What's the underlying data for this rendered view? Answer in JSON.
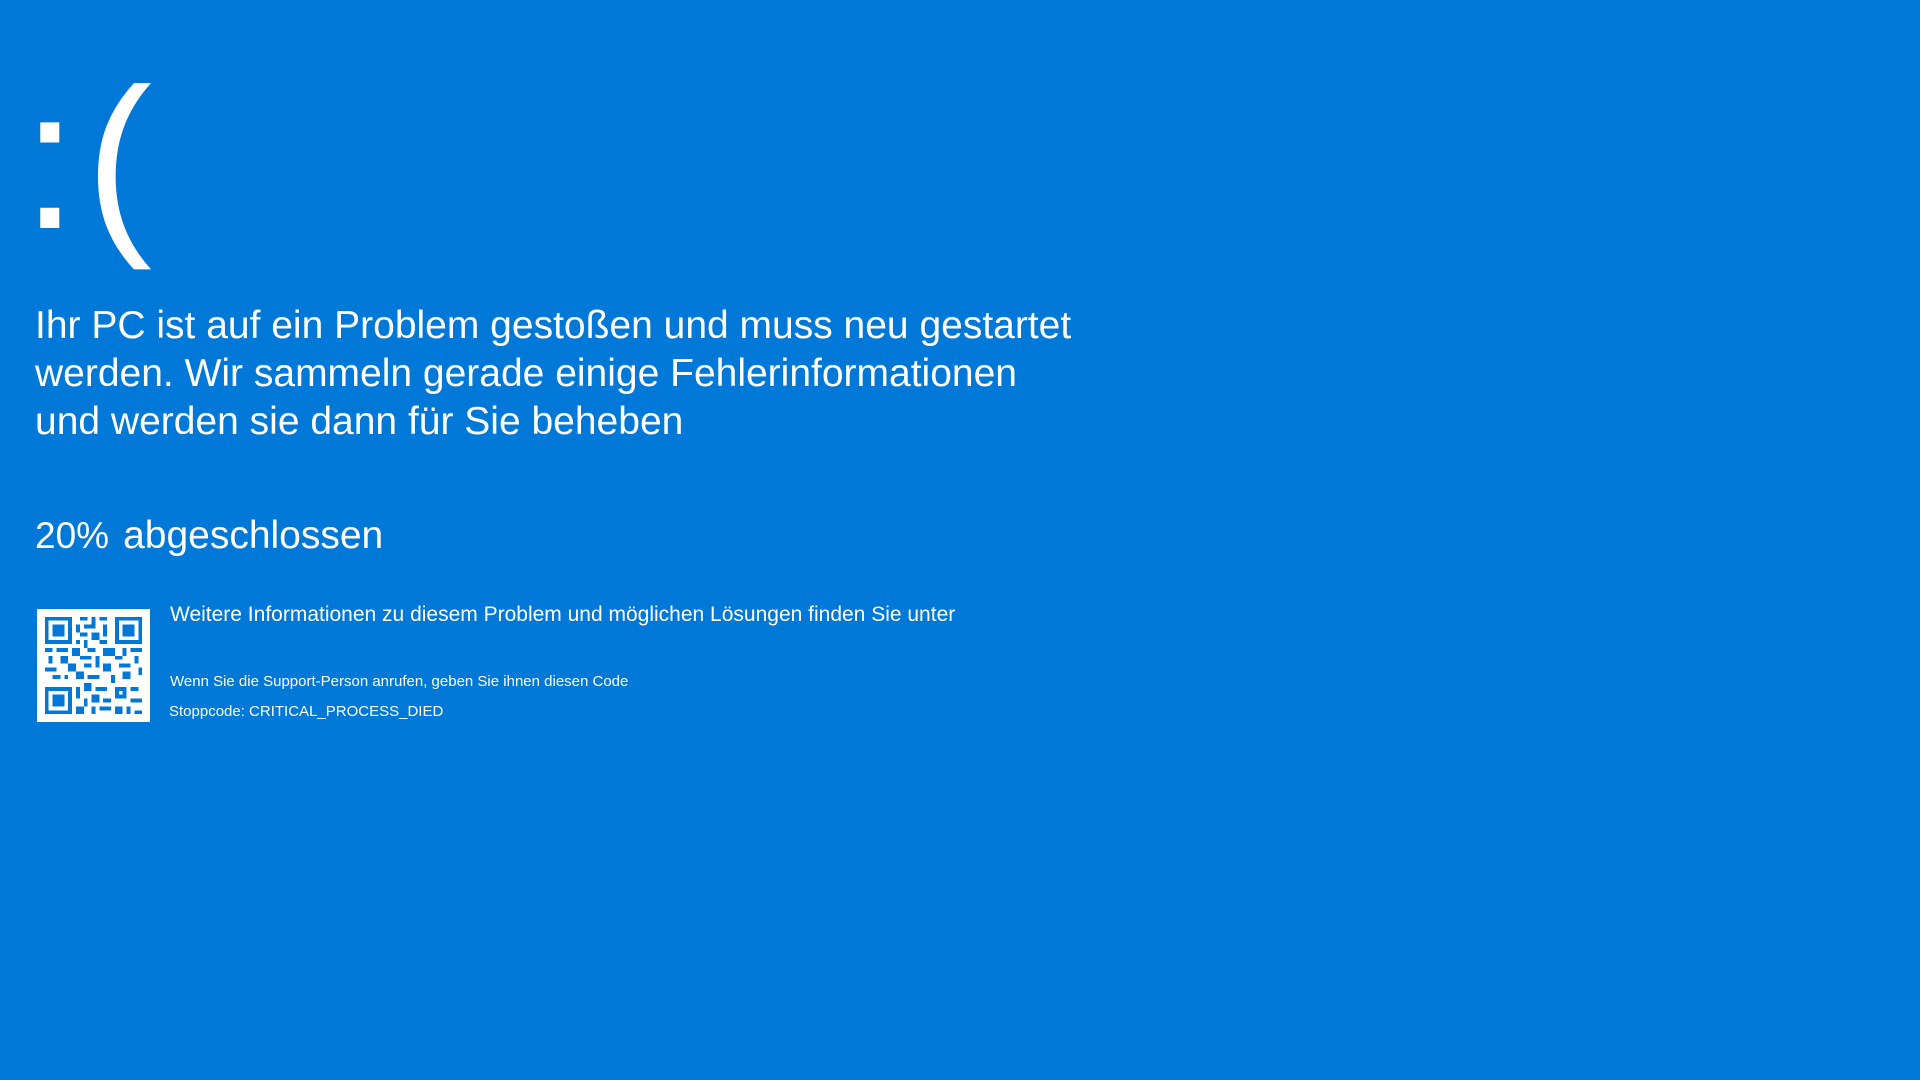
{
  "screen": {
    "background_color": "#0078d7",
    "text_color": "#ffffff",
    "sad_face": ":(",
    "message_lines": [
      "Ihr PC ist auf ein Problem gestoßen und muss neu gestartet",
      "werden. Wir sammeln gerade einige Fehlerinformationen",
      "und werden sie dann für Sie beheben"
    ],
    "progress": {
      "percent": "20%",
      "label": "abgeschlossen"
    },
    "qr_code": {
      "icon": "qr-code-icon"
    },
    "info_text": "Weitere Informationen zu diesem Problem und möglichen Lösungen finden Sie unter",
    "support_text": "Wenn Sie die Support-Person anrufen, geben Sie ihnen diesen Code",
    "stop_code_text": "Stoppcode: CRITICAL_PROCESS_DIED"
  }
}
